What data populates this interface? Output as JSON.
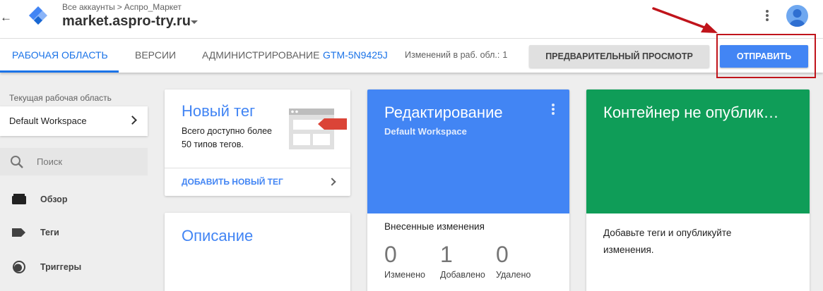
{
  "header": {
    "breadcrumb": [
      "Все аккаунты",
      "Аспро_Маркет"
    ],
    "breadcrumb_separator": ">",
    "container_name": "market.aspro-try.ru",
    "back_icon": "arrow-back-icon",
    "logo_icon": "gtm-logo-icon",
    "menu_icon": "more-vert-icon",
    "avatar_icon": "account-avatar-icon"
  },
  "nav": {
    "tabs": [
      {
        "label": "РАБОЧАЯ ОБЛАСТЬ",
        "active": true
      },
      {
        "label": "ВЕРСИИ",
        "active": false
      },
      {
        "label": "АДМИНИСТРИРОВАНИЕ",
        "active": false
      }
    ],
    "container_id": "GTM-5N9425J",
    "changes_label": "Изменений в раб. обл.:",
    "changes_count": "1",
    "preview_button": "ПРЕДВАРИТЕЛЬНЫЙ ПРОСМОТР",
    "submit_button": "ОТПРАВИТЬ",
    "accent_color": "#1a73e8"
  },
  "sidebar": {
    "workspace_label": "Текущая рабочая область",
    "workspace_name": "Default Workspace",
    "search_placeholder": "Поиск",
    "items": [
      {
        "label": "Обзор",
        "icon": "overview-icon"
      },
      {
        "label": "Теги",
        "icon": "tag-icon"
      },
      {
        "label": "Триггеры",
        "icon": "trigger-icon"
      }
    ]
  },
  "cards": {
    "new_tag": {
      "title": "Новый тег",
      "description": "Всего доступно более 50 типов тегов.",
      "link": "ДОБАВИТЬ НОВЫЙ ТЕГ"
    },
    "description": {
      "title": "Описание"
    },
    "editing": {
      "title": "Редактирование",
      "subtitle": "Default Workspace",
      "changes_title": "Внесенные изменения",
      "stats": [
        {
          "value": "0",
          "label": "Изменено"
        },
        {
          "value": "1",
          "label": "Добавлено"
        },
        {
          "value": "0",
          "label": "Удалено"
        }
      ],
      "color": "#4285f4"
    },
    "publish": {
      "title": "Контейнер не опублик…",
      "text": "Добавьте теги и опубликуйте изменения.",
      "color": "#0f9d58"
    }
  },
  "annotation": {
    "color": "#c0141b"
  }
}
